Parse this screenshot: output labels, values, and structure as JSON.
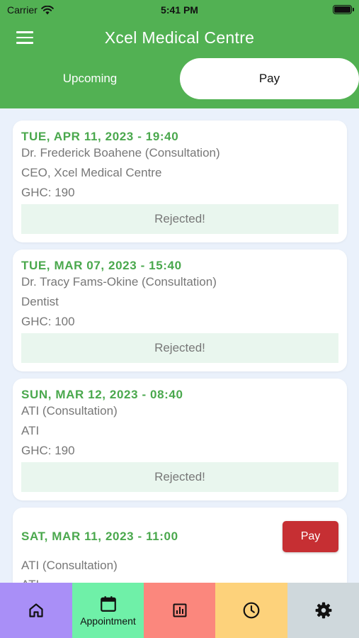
{
  "status_bar": {
    "carrier": "Carrier",
    "time": "5:41 PM"
  },
  "header": {
    "title": "Xcel Medical Centre",
    "menu_icon": "hamburger-menu-icon"
  },
  "tabs": [
    {
      "label": "Upcoming",
      "active": false
    },
    {
      "label": "Pay",
      "active": true
    }
  ],
  "appointments": [
    {
      "date": "TUE, APR 11, 2023 - 19:40",
      "doctor": "Dr. Frederick Boahene (Consultation)",
      "role": "CEO, Xcel Medical Centre",
      "fee": "GHC: 190",
      "status": "Rejected!"
    },
    {
      "date": "TUE, MAR 07, 2023 - 15:40",
      "doctor": "Dr. Tracy Fams-Okine (Consultation)",
      "role": "Dentist",
      "fee": "GHC: 100",
      "status": "Rejected!"
    },
    {
      "date": "SUN, MAR 12, 2023 - 08:40",
      "doctor": "ATI (Consultation)",
      "role": "ATI",
      "fee": "GHC: 190",
      "status": "Rejected!"
    },
    {
      "date": "SAT, MAR 11, 2023 - 11:00",
      "doctor": "ATI (Consultation)",
      "role": "ATI",
      "pay_label": "Pay"
    }
  ],
  "bottom_nav": [
    {
      "icon": "home-icon",
      "label": "",
      "color": "#a98ff7"
    },
    {
      "icon": "calendar-icon",
      "label": "Appointment",
      "color": "#6ff0a8"
    },
    {
      "icon": "chart-icon",
      "label": "",
      "color": "#fb877d"
    },
    {
      "icon": "clock-icon",
      "label": "",
      "color": "#fdd27b"
    },
    {
      "icon": "settings-icon",
      "label": "",
      "color": "#cfd8dc"
    }
  ],
  "colors": {
    "primary": "#52b153",
    "accent_green": "#4aa84d",
    "pay_button": "#c62f33",
    "background": "#eaf1fb",
    "status_bg": "#e9f6ee"
  }
}
